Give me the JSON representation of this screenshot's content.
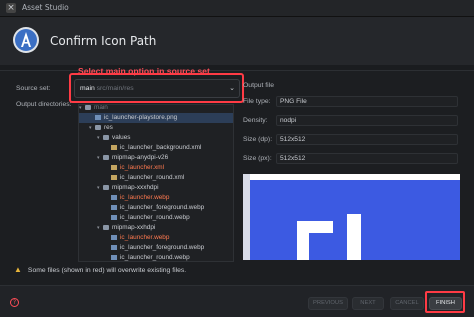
{
  "window": {
    "title": "Asset Studio"
  },
  "header": {
    "title": "Confirm Icon Path"
  },
  "annotation": {
    "text": "Select main option in source set"
  },
  "form": {
    "source_set_label": "Source set:",
    "source_set_value_main": "main",
    "source_set_value_path": "src/main/res",
    "output_dirs_label": "Output directories:"
  },
  "tree": [
    {
      "label": "main",
      "kind": "folder",
      "dim": true
    },
    {
      "label": "ic_launcher-playstore.png",
      "kind": "file",
      "selected": true
    },
    {
      "label": "res",
      "kind": "folder"
    },
    {
      "label": "values",
      "kind": "folder"
    },
    {
      "label": "ic_launcher_background.xml",
      "kind": "xml"
    },
    {
      "label": "mipmap-anydpi-v26",
      "kind": "folder"
    },
    {
      "label": "ic_launcher.xml",
      "kind": "xml",
      "red": true
    },
    {
      "label": "ic_launcher_round.xml",
      "kind": "xml"
    },
    {
      "label": "mipmap-xxxhdpi",
      "kind": "folder"
    },
    {
      "label": "ic_launcher.webp",
      "kind": "file",
      "red": true
    },
    {
      "label": "ic_launcher_foreground.webp",
      "kind": "file"
    },
    {
      "label": "ic_launcher_round.webp",
      "kind": "file"
    },
    {
      "label": "mipmap-xxhdpi",
      "kind": "folder"
    },
    {
      "label": "ic_launcher.webp",
      "kind": "file",
      "red": true
    },
    {
      "label": "ic_launcher_foreground.webp",
      "kind": "file"
    },
    {
      "label": "ic_launcher_round.webp",
      "kind": "file"
    }
  ],
  "output_file": {
    "heading": "Output file",
    "file_type_label": "File type:",
    "file_type_value": "PNG File",
    "density_label": "Density:",
    "density_value": "nodpi",
    "size_dp_label": "Size (dp):",
    "size_dp_value": "512x512",
    "size_px_label": "Size (px):",
    "size_px_value": "512x512"
  },
  "warning": {
    "text": "Some files (shown in red) will overwrite existing files."
  },
  "footer": {
    "help": "?",
    "previous": "PREVIOUS",
    "next": "NEXT",
    "cancel": "CANCEL",
    "finish": "FINISH"
  },
  "colors": {
    "accent_red": "#ff3b45",
    "preview_blue": "#3c5ae2",
    "overwrite_red": "#ff7a50"
  }
}
